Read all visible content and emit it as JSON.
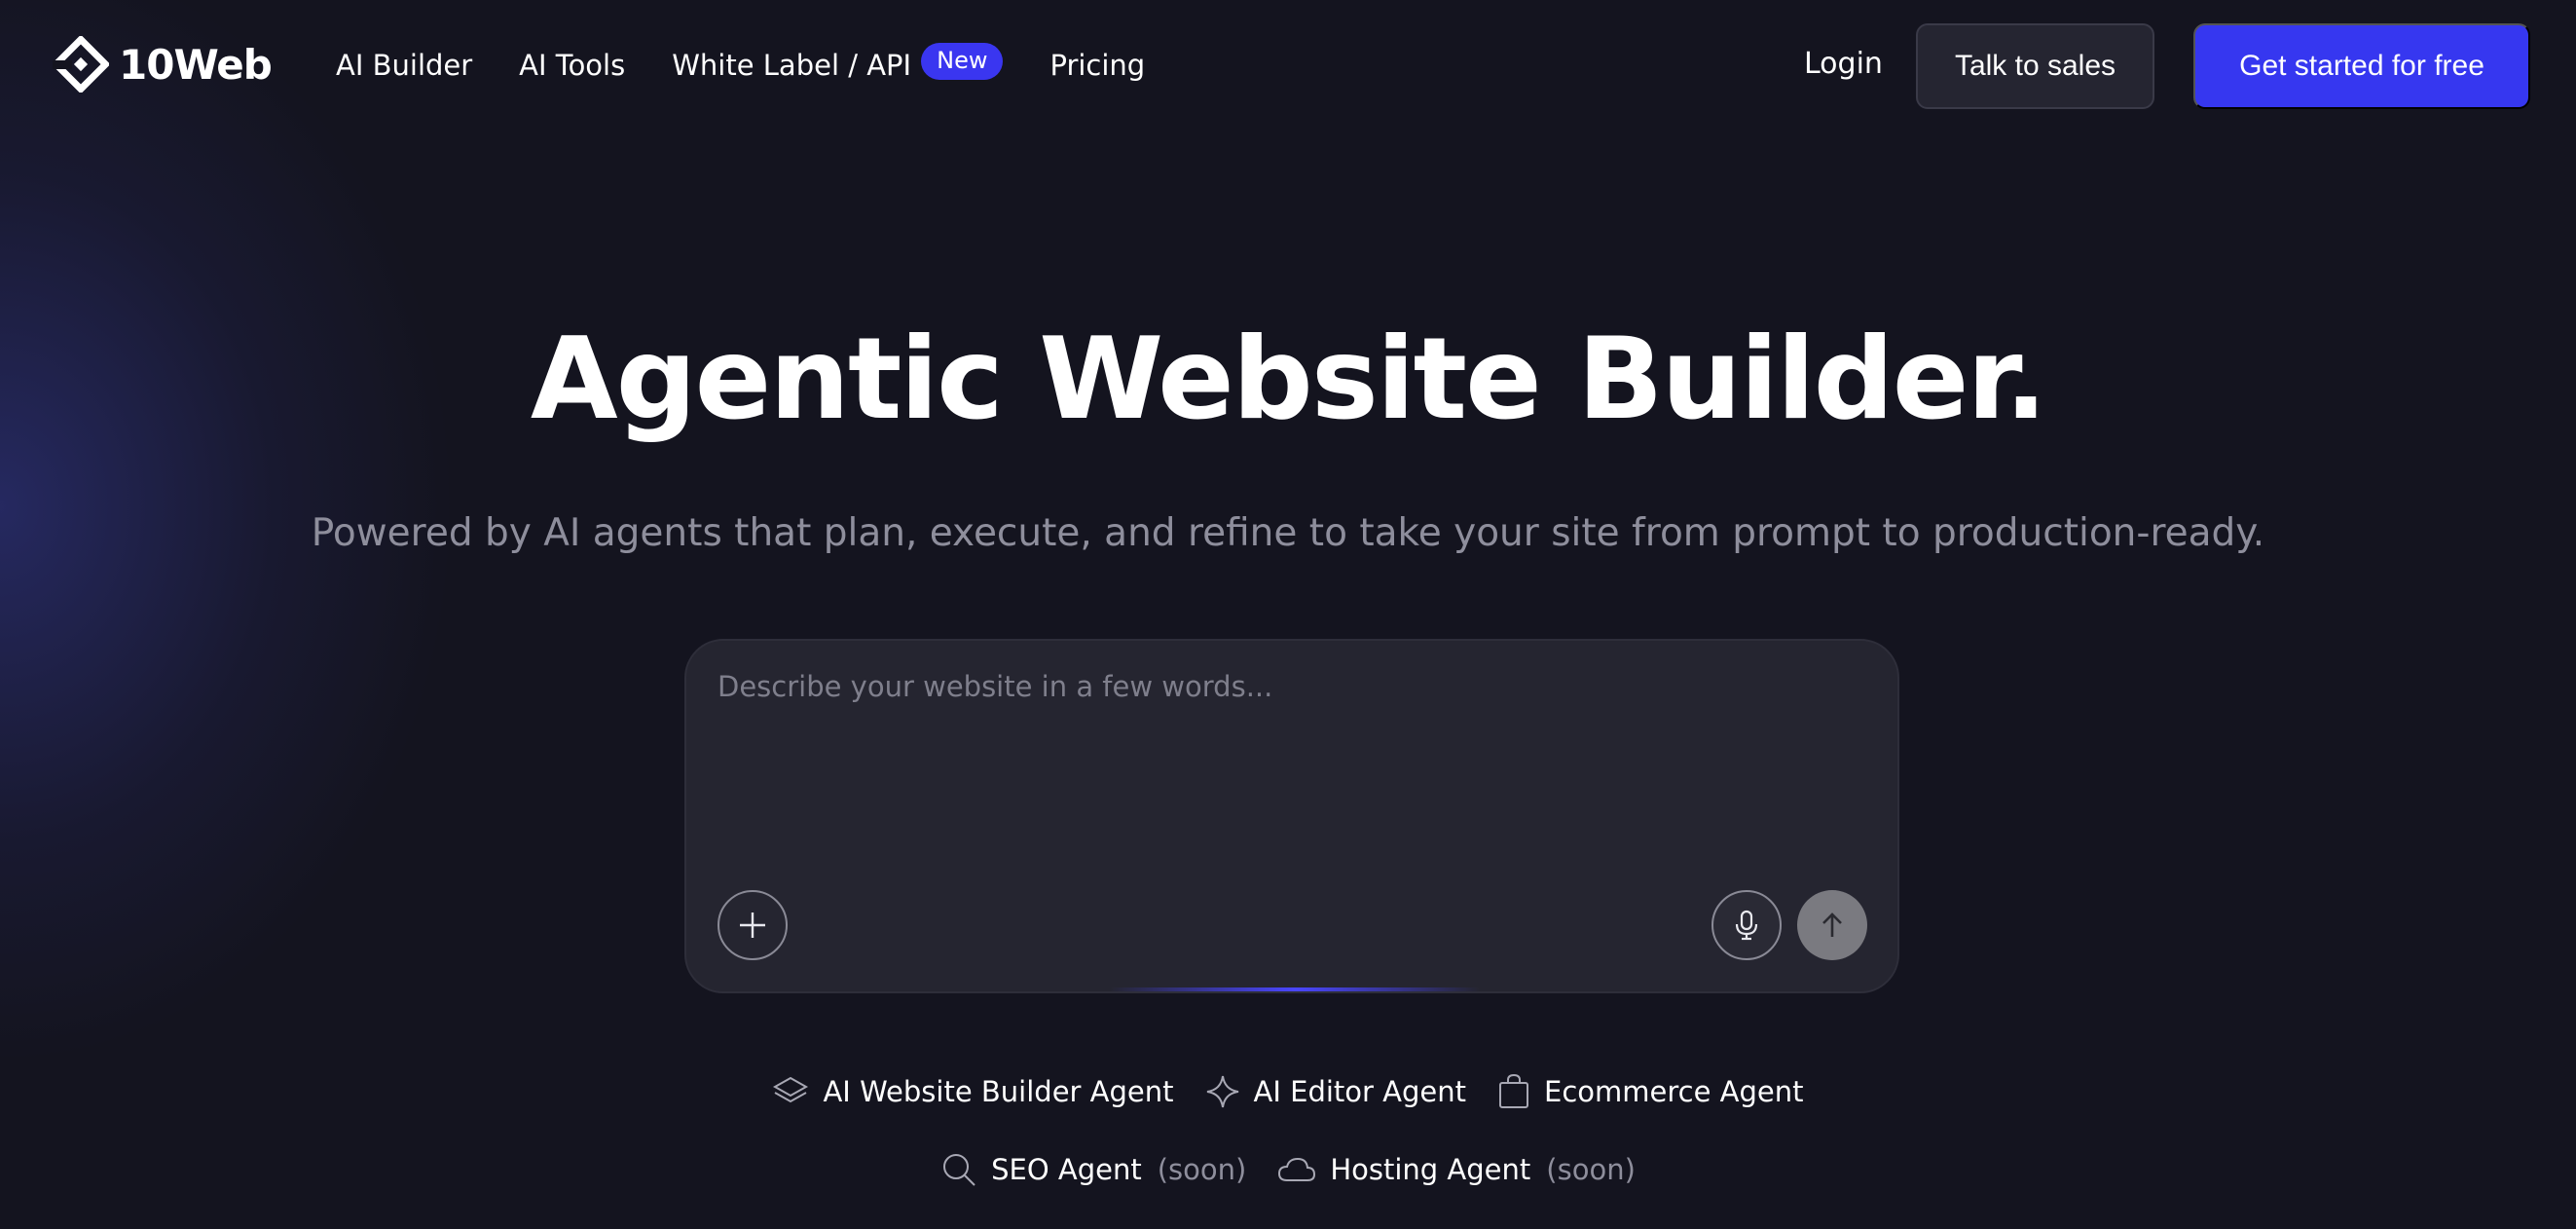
{
  "brand": {
    "name": "10Web",
    "icon": "10web-logo-icon"
  },
  "nav": {
    "items": [
      {
        "label": "AI Builder"
      },
      {
        "label": "AI Tools"
      },
      {
        "label": "White Label / API",
        "badge": "New"
      },
      {
        "label": "Pricing"
      }
    ],
    "login_label": "Login",
    "sales_label": "Talk to sales",
    "start_label": "Get started for free"
  },
  "hero": {
    "title": "Agentic Website Builder.",
    "subtitle": "Powered by AI agents that plan, execute, and refine to take your site from prompt to production-ready."
  },
  "prompt": {
    "placeholder": "Describe your website in a few words...",
    "value": "",
    "icons": {
      "add": "plus-icon",
      "mic": "microphone-icon",
      "send": "arrow-up-icon"
    }
  },
  "agents": {
    "row1": [
      {
        "label": "AI Website Builder Agent",
        "icon": "layers-icon"
      },
      {
        "label": "AI Editor Agent",
        "icon": "sparkle-icon"
      },
      {
        "label": "Ecommerce Agent",
        "icon": "shopping-bag-icon"
      }
    ],
    "row2": [
      {
        "label": "SEO Agent",
        "soon": "(soon)",
        "icon": "search-icon"
      },
      {
        "label": "Hosting Agent",
        "soon": "(soon)",
        "icon": "cloud-icon"
      }
    ]
  },
  "colors": {
    "background": "#14141f",
    "accent": "#3637f0",
    "badge": "#3a36f0",
    "muted_text": "#8e8e9c",
    "prompt_bg": "#252530"
  }
}
